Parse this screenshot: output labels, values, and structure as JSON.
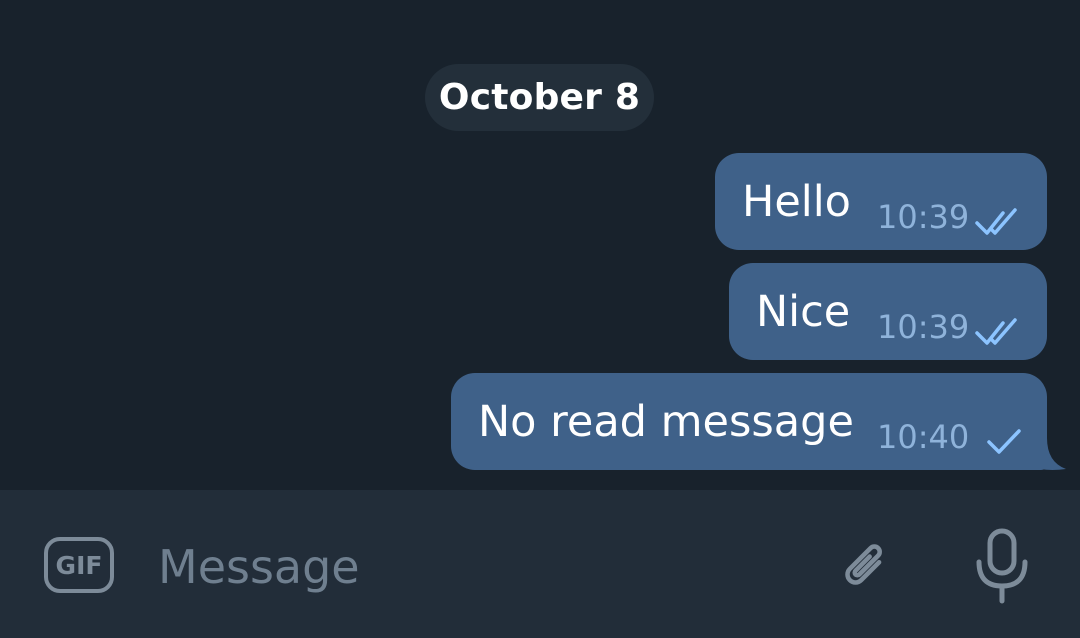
{
  "chat": {
    "date_label": "October 8",
    "messages": [
      {
        "text": "Hello",
        "time": "10:39",
        "status": "read",
        "status_icon": "double-check-icon"
      },
      {
        "text": "Nice",
        "time": "10:39",
        "status": "read",
        "status_icon": "double-check-icon"
      },
      {
        "text": "No read message",
        "time": "10:40",
        "status": "sent",
        "status_icon": "single-check-icon"
      }
    ]
  },
  "composer": {
    "gif_label": "GIF",
    "placeholder": "Message",
    "attach_icon": "paperclip-icon",
    "mic_icon": "microphone-icon"
  },
  "colors": {
    "background": "#18222c",
    "date_pill": "#232f3a",
    "outgoing_bubble": "#3f6189",
    "meta_text": "#8fb3da",
    "input_bar": "#222d39",
    "icon_gray": "#7d8b99"
  }
}
